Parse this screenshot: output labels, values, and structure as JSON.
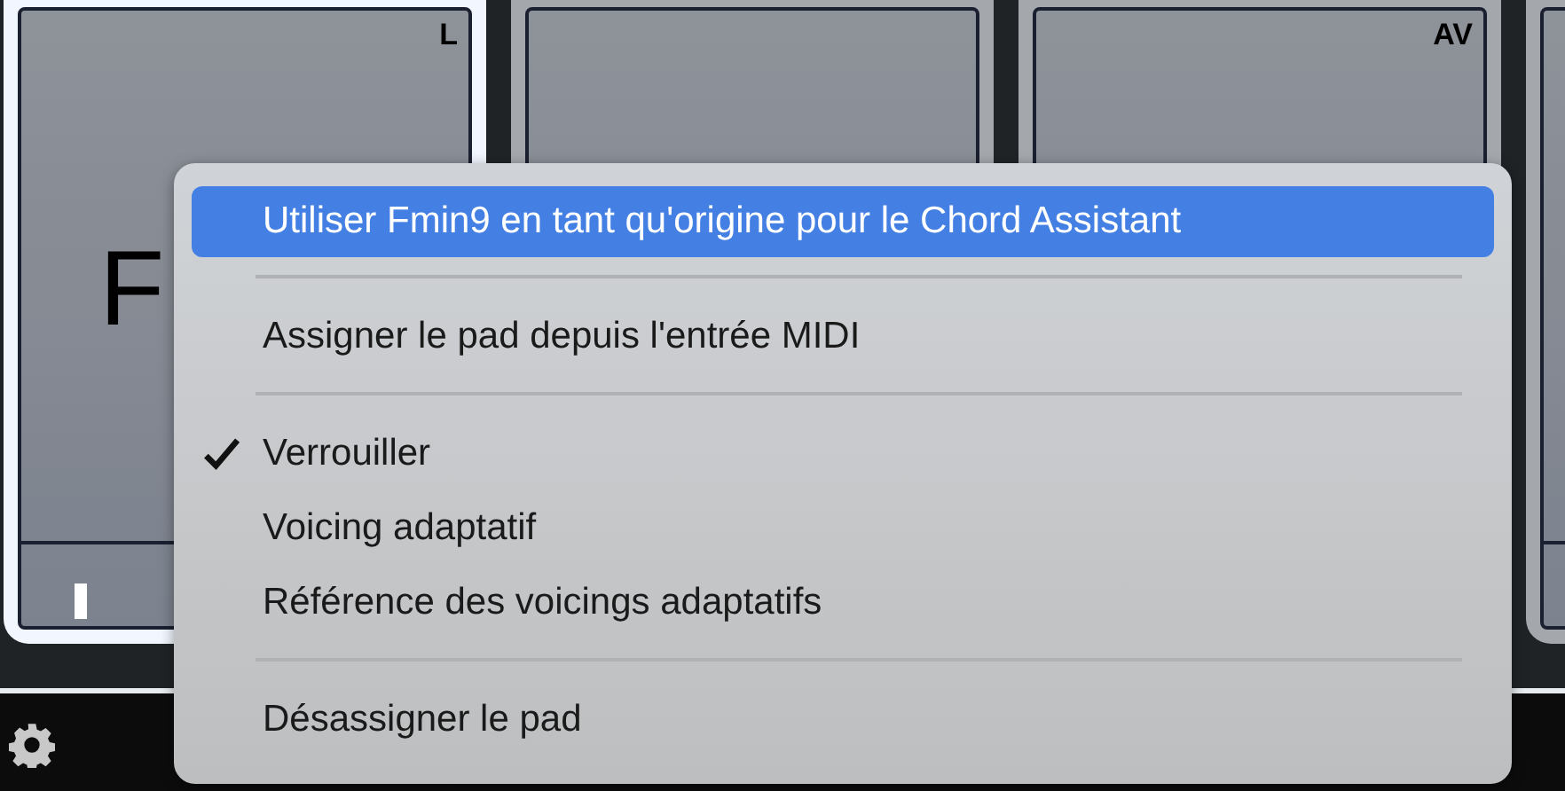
{
  "pads": [
    {
      "label": "F",
      "badge": "L",
      "selected": true,
      "marker": true
    },
    {
      "selected": false
    },
    {
      "badge": "AV",
      "selected": false
    },
    {
      "selected": false
    }
  ],
  "context_menu": {
    "items": [
      {
        "kind": "item",
        "label": "Utiliser Fmin9 en tant qu'origine pour le Chord Assistant",
        "highlighted": true,
        "checked": false
      },
      {
        "kind": "separator"
      },
      {
        "kind": "item",
        "label": "Assigner le pad depuis l'entrée MIDI",
        "highlighted": false,
        "checked": false
      },
      {
        "kind": "separator"
      },
      {
        "kind": "item",
        "label": "Verrouiller",
        "highlighted": false,
        "checked": true
      },
      {
        "kind": "item",
        "label": "Voicing adaptatif",
        "highlighted": false,
        "checked": false
      },
      {
        "kind": "item",
        "label": "Référence des voicings adaptatifs",
        "highlighted": false,
        "checked": false
      },
      {
        "kind": "separator"
      },
      {
        "kind": "item",
        "label": "Désassigner le pad",
        "highlighted": false,
        "checked": false
      }
    ]
  }
}
